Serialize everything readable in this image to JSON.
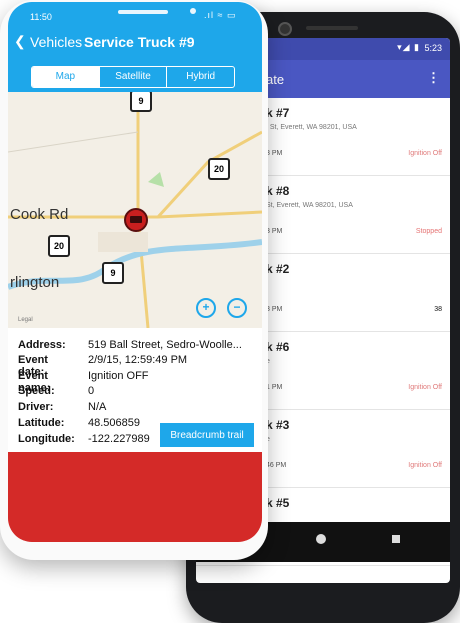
{
  "android": {
    "status": {
      "time": "5:23",
      "icons": "▾◢ ▮"
    },
    "appbar": {
      "title": "ate",
      "menu": "⋮"
    },
    "items": [
      {
        "name": "k #7",
        "addr": "t St, Everett, WA 98201, USA",
        "time": "3 PM",
        "status": "Ignition Off",
        "statusColor": "#e07a7a"
      },
      {
        "name": "k #8",
        "addr": "St, Everett, WA 98201, USA",
        "time": "3 PM",
        "status": "Stopped",
        "statusColor": "#e57373"
      },
      {
        "name": "k #2",
        "addr": "",
        "time": "3 PM",
        "status": "38",
        "statusColor": "#111"
      },
      {
        "name": "k #6",
        "addr": "e",
        "time": "1 PM",
        "status": "Ignition Off",
        "statusColor": "#e07a7a"
      },
      {
        "name": "k #3",
        "addr": "e",
        "time": "46 PM",
        "status": "Ignition Off",
        "statusColor": "#e07a7a"
      },
      {
        "name": "k #5",
        "addr": "",
        "time": "",
        "status": "",
        "statusColor": "#111"
      }
    ]
  },
  "iphone": {
    "status": {
      "time": "11:50",
      "icons": ".ıl ≈ ▭"
    },
    "nav": {
      "back_label": "Vehicles",
      "title": "Service Truck #9"
    },
    "segments": [
      "Map",
      "Satellite",
      "Hybrid"
    ],
    "map": {
      "labels": [
        "Cook Rd",
        "rlington"
      ],
      "legal": "Legal",
      "shields": [
        {
          "text": "9"
        },
        {
          "text": "20"
        },
        {
          "text": "20"
        },
        {
          "text": "9"
        }
      ]
    },
    "details": [
      {
        "label": "Address:",
        "value": "519 Ball Street, Sedro-Woolle..."
      },
      {
        "label": "Event date:",
        "value": "2/9/15, 12:59:49 PM"
      },
      {
        "label": "Event name:",
        "value": "Ignition OFF"
      },
      {
        "label": "Speed:",
        "value": "0"
      },
      {
        "label": "Driver:",
        "value": "N/A"
      },
      {
        "label": "Latitude:",
        "value": "48.506859"
      },
      {
        "label": "Longitude:",
        "value": "-122.227989"
      }
    ],
    "button": "Breadcrumb trail"
  }
}
